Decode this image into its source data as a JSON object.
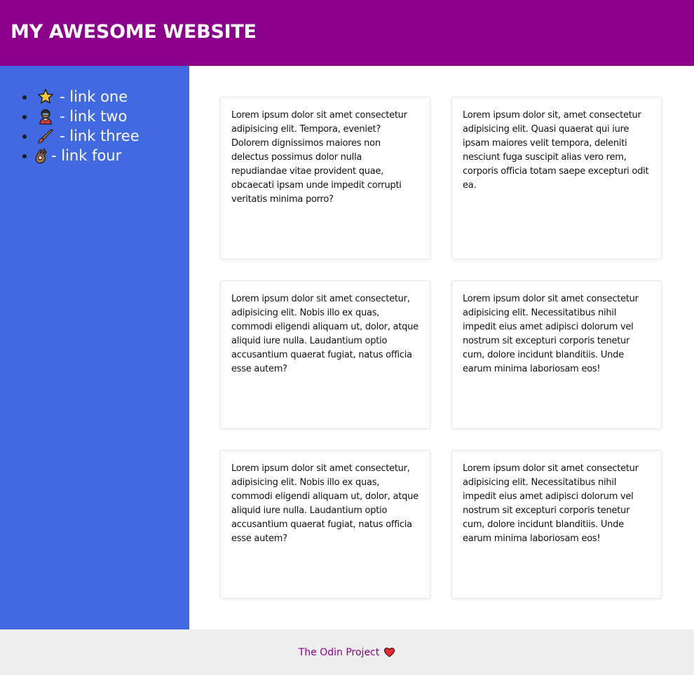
{
  "header": {
    "title": "MY AWESOME WEBSITE",
    "background": "#8b008b"
  },
  "sidebar": {
    "background": "#4169e1",
    "items": [
      {
        "icon": "star-icon",
        "label": "- link one"
      },
      {
        "icon": "person-icon",
        "label": "- link two"
      },
      {
        "icon": "paintbrush-icon",
        "label": "- link three"
      },
      {
        "icon": "ok-hand-icon",
        "label": "- link four"
      }
    ]
  },
  "cards": [
    {
      "text": "Lorem ipsum dolor sit amet consectetur adipisicing elit. Tempora, eveniet? Dolorem dignissimos maiores non delectus possimus dolor nulla repudiandae vitae provident quae, obcaecati ipsam unde impedit corrupti veritatis minima porro?"
    },
    {
      "text": "Lorem ipsum dolor sit, amet consectetur adipisicing elit. Quasi quaerat qui iure ipsam maiores velit tempora, deleniti nesciunt fuga suscipit alias vero rem, corporis officia totam saepe excepturi odit ea."
    },
    {
      "text": "Lorem ipsum dolor sit amet consectetur, adipisicing elit. Nobis illo ex quas, commodi eligendi aliquam ut, dolor, atque aliquid iure nulla. Laudantium optio accusantium quaerat fugiat, natus officia esse autem?"
    },
    {
      "text": "Lorem ipsum dolor sit amet consectetur adipisicing elit. Necessitatibus nihil impedit eius amet adipisci dolorum vel nostrum sit excepturi corporis tenetur cum, dolore incidunt blanditiis. Unde earum minima laboriosam eos!"
    },
    {
      "text": "Lorem ipsum dolor sit amet consectetur, adipisicing elit. Nobis illo ex quas, commodi eligendi aliquam ut, dolor, atque aliquid iure nulla. Laudantium optio accusantium quaerat fugiat, natus officia esse autem?"
    },
    {
      "text": "Lorem ipsum dolor sit amet consectetur adipisicing elit. Necessitatibus nihil impedit eius amet adipisci dolorum vel nostrum sit excepturi corporis tenetur cum, dolore incidunt blanditiis. Unde earum minima laboriosam eos!"
    }
  ],
  "footer": {
    "credit": "The Odin Project",
    "icon": "heart-icon",
    "link_color": "#8b008b",
    "background": "#eeeeee"
  }
}
